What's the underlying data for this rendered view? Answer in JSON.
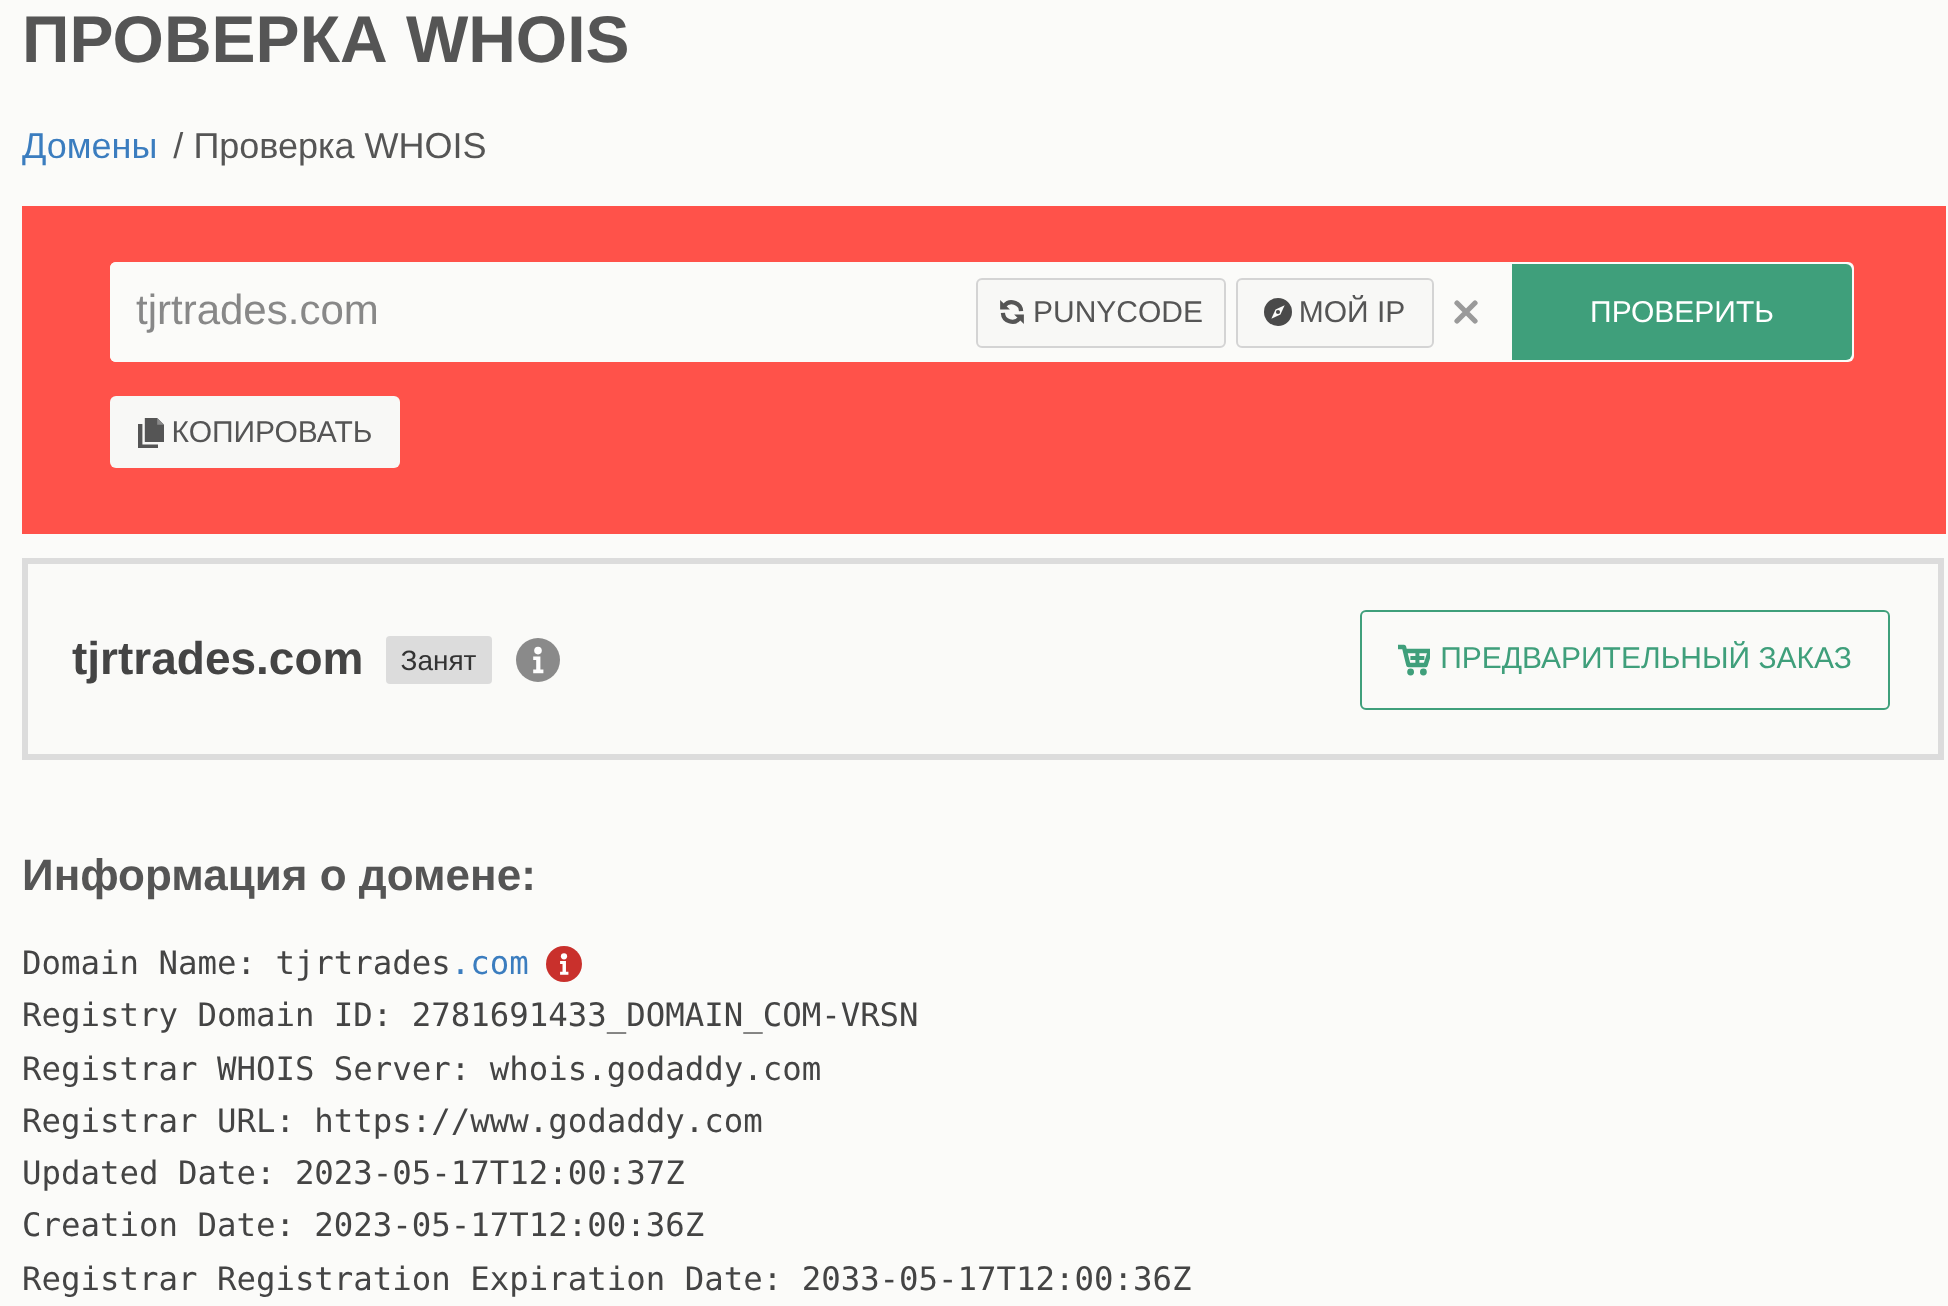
{
  "page": {
    "title": "ПРОВЕРКА WHOIS"
  },
  "breadcrumb": {
    "separator": "/",
    "items": [
      {
        "label": "Домены",
        "link": true
      },
      {
        "label": "Проверка WHOIS",
        "link": false
      }
    ]
  },
  "search": {
    "value": "tjrtrades.com",
    "tools": [
      {
        "kind": "punycode",
        "label": "PUNYCODE"
      },
      {
        "kind": "my_ip",
        "label": "МОЙ IP"
      }
    ],
    "submit": "ПРОВЕРИТЬ",
    "copy": "КОПИРОВАТЬ"
  },
  "result": {
    "domain": "tjrtrades.com",
    "status": "Занят",
    "action": "ПРЕДВАРИТЕЛЬНЫЙ ЗАКАЗ"
  },
  "info": {
    "heading": "Информация о домене:",
    "lines": [
      {
        "kind": "domain",
        "text": "Domain Name: tjrtrades",
        "link": ".com"
      },
      {
        "kind": "plain",
        "text": "Registry Domain ID: 2781691433_DOMAIN_COM-VRSN"
      },
      {
        "kind": "plain",
        "text": "Registrar WHOIS Server: whois.godaddy.com"
      },
      {
        "kind": "plain",
        "text": "Registrar URL: https://www.godaddy.com"
      },
      {
        "kind": "plain",
        "text": "Updated Date: 2023-05-17T12:00:37Z"
      },
      {
        "kind": "plain",
        "text": "Creation Date: 2023-05-17T12:00:36Z"
      },
      {
        "kind": "plain",
        "text": "Registrar Registration Expiration Date: 2033-05-17T12:00:36Z"
      }
    ]
  }
}
